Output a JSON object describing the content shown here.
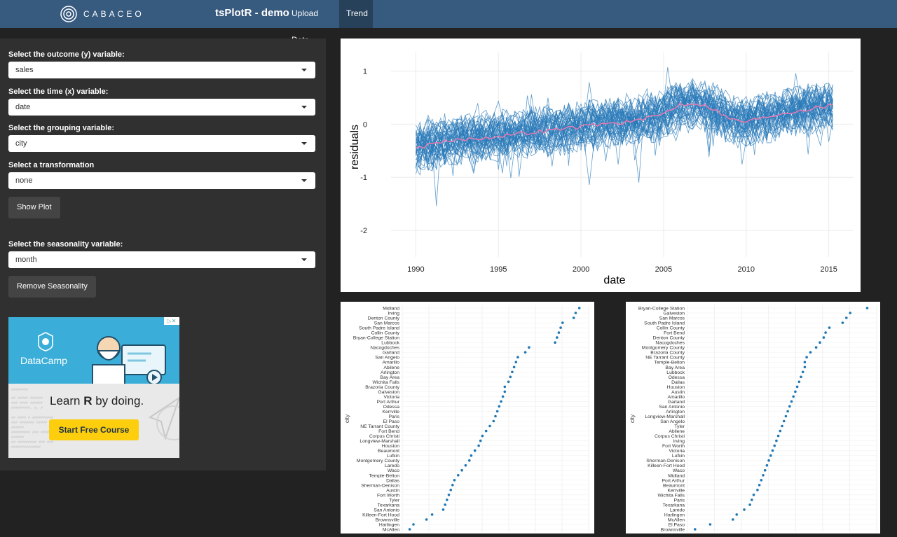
{
  "navbar": {
    "logo_text": "CABACEO",
    "app_title": "tsPlotR - demo",
    "tabs": [
      {
        "label": "Upload Data",
        "active": false
      },
      {
        "label": "Trend",
        "active": true
      }
    ]
  },
  "sidebar": {
    "outcome": {
      "label": "Select the outcome (y) variable:",
      "value": "sales"
    },
    "time": {
      "label": "Select the time (x) variable:",
      "value": "date"
    },
    "grouping": {
      "label": "Select the grouping variable:",
      "value": "city"
    },
    "transformation": {
      "label": "Select a transformation",
      "value": "none"
    },
    "show_plot_button": "Show Plot",
    "seasonality": {
      "label": "Select the seasonality variable:",
      "value": "month"
    },
    "remove_seasonality_button": "Remove Seasonality"
  },
  "ad": {
    "brand": "DataCamp",
    "tagline_pre": "Learn ",
    "tagline_bold": "R",
    "tagline_post": " by doing.",
    "cta": "Start Free Course"
  },
  "colors": {
    "navbar": "#375a7f",
    "active_tab": "#28415b",
    "series_line": "#2b7bba",
    "mean_line": "#e07ab0",
    "dot": "#1f77b4"
  },
  "chart_data": [
    {
      "type": "line",
      "xlabel": "date",
      "ylabel": "residuals",
      "x_ticks": [
        "1990",
        "1995",
        "2000",
        "2005",
        "2010",
        "2015"
      ],
      "y_ticks": [
        "-2",
        "-1",
        "0",
        "1"
      ],
      "xlim": [
        1988.5,
        2016.5
      ],
      "ylim": [
        -2.5,
        1.35
      ],
      "grid": true,
      "series": [
        {
          "kind": "city",
          "count": 46
        },
        {
          "kind": "mean",
          "x": [
            1990,
            1991,
            1992,
            1993,
            1994,
            1995,
            1996,
            1997,
            1998,
            1999,
            2000,
            2001,
            2002,
            2003,
            2004,
            2005,
            2006,
            2007,
            2008,
            2009,
            2010,
            2011,
            2012,
            2013,
            2014,
            2015
          ],
          "y": [
            -0.45,
            -0.38,
            -0.32,
            -0.28,
            -0.26,
            -0.22,
            -0.19,
            -0.15,
            -0.12,
            -0.08,
            -0.05,
            0.0,
            0.02,
            0.05,
            0.1,
            0.2,
            0.38,
            0.4,
            0.3,
            0.1,
            0.05,
            0.12,
            0.2,
            0.25,
            0.3,
            0.35
          ]
        }
      ]
    },
    {
      "type": "scatter",
      "ylabel": "city",
      "categories": [
        "Midland",
        "Irving",
        "Denton County",
        "San Marcos",
        "South Padre Island",
        "Collin County",
        "Bryan-College Station",
        "Lubbock",
        "Nacogdoches",
        "Garland",
        "San Angelo",
        "Amarillo",
        "Abilene",
        "Arlington",
        "Bay Area",
        "Wichita Falls",
        "Brazoria County",
        "Galveston",
        "Victoria",
        "Port Arthur",
        "Odessa",
        "Kerrville",
        "Paris",
        "El Paso",
        "NE Tarrant County",
        "Fort Bend",
        "Corpus Christi",
        "Longview-Marshall",
        "Houston",
        "Beaumont",
        "Lufkin",
        "Montgomery County",
        "Laredo",
        "Waco",
        "Temple-Belton",
        "Dallas",
        "Sherman-Denison",
        "Austin",
        "Fort Worth",
        "Tyler",
        "Texarkana",
        "San Antonio",
        "Killeen-Fort Hood",
        "Brownsville",
        "Harlingen",
        "McAllen"
      ],
      "values": [
        0.95,
        0.93,
        0.92,
        0.86,
        0.85,
        0.84,
        0.83,
        0.82,
        0.68,
        0.66,
        0.62,
        0.61,
        0.6,
        0.59,
        0.58,
        0.57,
        0.55,
        0.55,
        0.54,
        0.53,
        0.52,
        0.51,
        0.5,
        0.49,
        0.47,
        0.45,
        0.43,
        0.42,
        0.41,
        0.39,
        0.37,
        0.36,
        0.34,
        0.32,
        0.3,
        0.28,
        0.27,
        0.26,
        0.25,
        0.24,
        0.23,
        0.22,
        0.16,
        0.13,
        0.06,
        0.04
      ]
    },
    {
      "type": "scatter",
      "ylabel": "city",
      "categories": [
        "Bryan-College Station",
        "Galveston",
        "San Marcos",
        "South Padre Island",
        "Collin County",
        "Fort Bend",
        "Denton County",
        "Nacogdoches",
        "Montgomery County",
        "Brazoria County",
        "NE Tarrant County",
        "Temple-Belton",
        "Bay Area",
        "Lubbock",
        "Odessa",
        "Dallas",
        "Houston",
        "Austin",
        "Amarillo",
        "Garland",
        "San Antonio",
        "Arlington",
        "Longview-Marshall",
        "San Angelo",
        "Tyler",
        "Abilene",
        "Corpus Christi",
        "Irving",
        "Fort Worth",
        "Victoria",
        "Lufkin",
        "Sherman-Denison",
        "Killeen-Fort Hood",
        "Waco",
        "Midland",
        "Port Arthur",
        "Beaumont",
        "Kerrville",
        "Wichita Falls",
        "Paris",
        "Texarkana",
        "Laredo",
        "Harlingen",
        "McAllen",
        "El Paso",
        "Brownsville"
      ],
      "values": [
        0.95,
        0.86,
        0.84,
        0.82,
        0.75,
        0.73,
        0.72,
        0.7,
        0.68,
        0.65,
        0.63,
        0.62,
        0.62,
        0.61,
        0.6,
        0.59,
        0.58,
        0.57,
        0.56,
        0.55,
        0.54,
        0.53,
        0.52,
        0.51,
        0.5,
        0.49,
        0.48,
        0.47,
        0.46,
        0.45,
        0.44,
        0.43,
        0.42,
        0.41,
        0.4,
        0.39,
        0.38,
        0.37,
        0.35,
        0.34,
        0.33,
        0.3,
        0.26,
        0.24,
        0.12,
        0.04
      ]
    }
  ]
}
